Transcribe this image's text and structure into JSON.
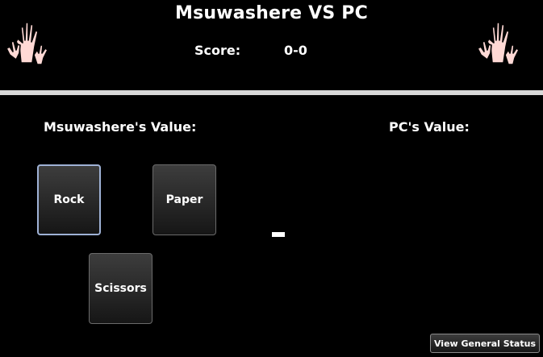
{
  "header": {
    "title": "Msuwashere VS PC",
    "score_label": "Score:",
    "score_value": "0-0",
    "left_icon": "raised-hands-icon",
    "right_icon": "raised-hands-icon"
  },
  "player": {
    "value_label": "Msuwashere's Value:",
    "choices": [
      {
        "label": "Rock",
        "selected": true
      },
      {
        "label": "Paper",
        "selected": false
      },
      {
        "label": "Scissors",
        "selected": false
      }
    ]
  },
  "pc": {
    "value_label": "PC's Value:"
  },
  "footer": {
    "status_button_label": "View General Status"
  },
  "colors": {
    "background": "#000000",
    "divider": "#d9d9d9",
    "hand_fill": "#ffd9d5",
    "selected_border": "#9fb2d6"
  }
}
